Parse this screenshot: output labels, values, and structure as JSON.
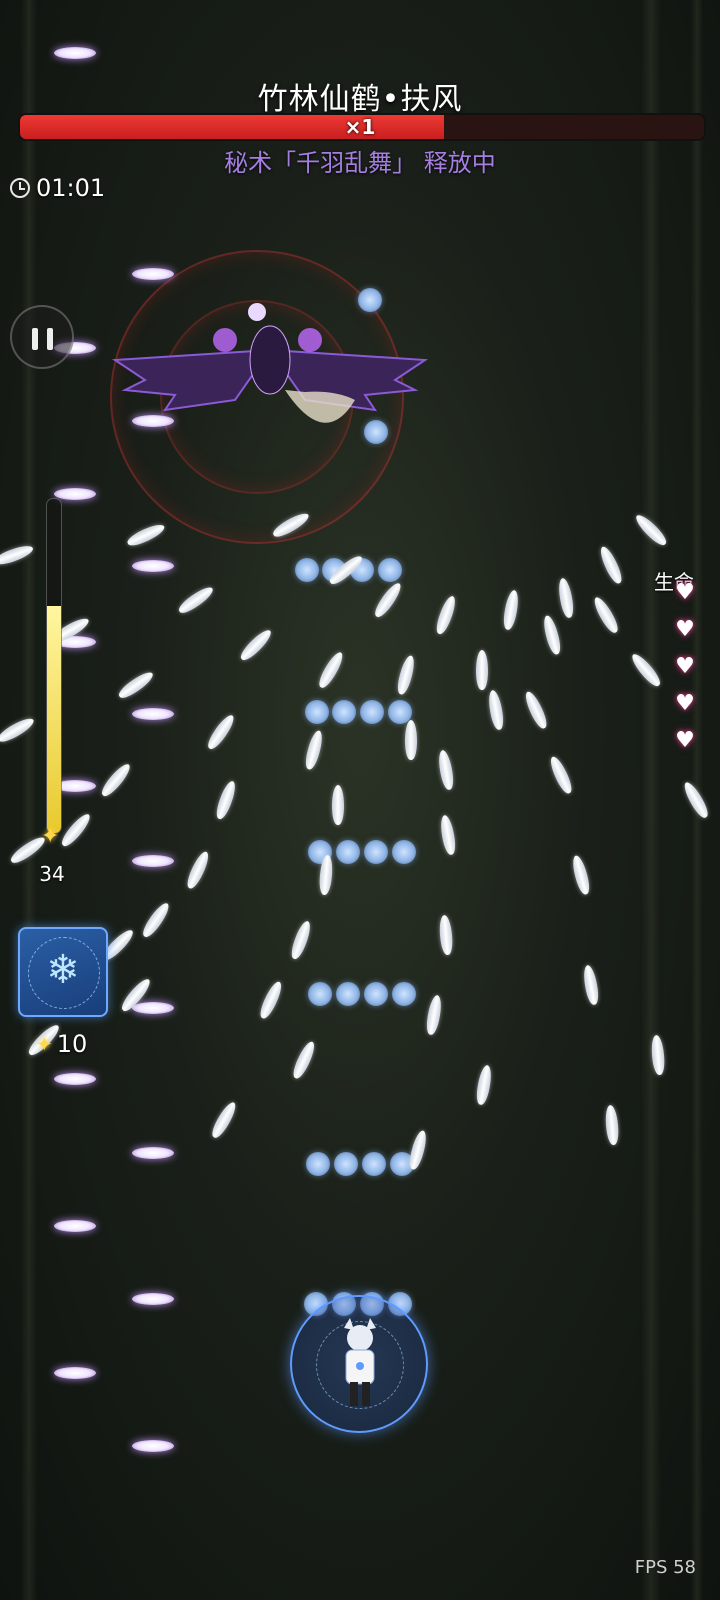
{
  "boss": {
    "name": "竹林仙鹤•扶风",
    "multiplier": "×1",
    "hp_fraction": 0.62,
    "spell_status": "秘术「千羽乱舞」 释放中"
  },
  "hud": {
    "timer": "01:01",
    "power_count": "34",
    "power_fraction": 0.68,
    "bomb_count": "10",
    "life_label": "生命",
    "lives": 5,
    "fps": "FPS 58"
  },
  "icons": {
    "clock": "clock-icon",
    "pause": "pause-icon",
    "star": "star-icon",
    "heart": "heart-icon",
    "skill": "snowflake-rune-icon"
  },
  "colors": {
    "hp_bar": "#e53030",
    "spell_text": "#a57ee0",
    "power_fill": "#e8c92d",
    "shield": "#5f9bff"
  }
}
